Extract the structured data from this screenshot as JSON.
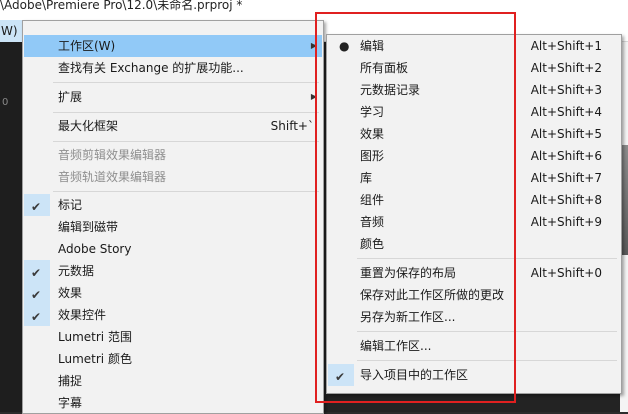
{
  "window": {
    "title": "\\Adobe\\Premiere Pro\\12.0\\未命名.prproj *",
    "menubar_selected": "W)"
  },
  "app": {
    "panel_number": "0"
  },
  "window_menu": {
    "items": [
      {
        "label": "工作区(W)",
        "highlight": true,
        "submenu": true
      },
      {
        "label": "查找有关 Exchange 的扩展功能..."
      },
      {
        "label": "扩展",
        "submenu": true
      },
      {
        "label": "最大化框架",
        "shortcut": "Shift+`"
      },
      {
        "label": "音频剪辑效果编辑器",
        "disabled": true
      },
      {
        "label": "音频轨道效果编辑器",
        "disabled": true
      },
      {
        "label": "标记",
        "checked": true
      },
      {
        "label": "编辑到磁带"
      },
      {
        "label": "Adobe Story"
      },
      {
        "label": "元数据",
        "checked": true
      },
      {
        "label": "效果",
        "checked": true
      },
      {
        "label": "效果控件",
        "checked": true
      },
      {
        "label": "Lumetri 范围"
      },
      {
        "label": "Lumetri 颜色"
      },
      {
        "label": "捕捉"
      },
      {
        "label": "字幕"
      }
    ]
  },
  "workspace_menu": {
    "items": [
      {
        "label": "编辑",
        "shortcut": "Alt+Shift+1",
        "active": true
      },
      {
        "label": "所有面板",
        "shortcut": "Alt+Shift+2"
      },
      {
        "label": "元数据记录",
        "shortcut": "Alt+Shift+3"
      },
      {
        "label": "学习",
        "shortcut": "Alt+Shift+4"
      },
      {
        "label": "效果",
        "shortcut": "Alt+Shift+5"
      },
      {
        "label": "图形",
        "shortcut": "Alt+Shift+6"
      },
      {
        "label": "库",
        "shortcut": "Alt+Shift+7"
      },
      {
        "label": "组件",
        "shortcut": "Alt+Shift+8"
      },
      {
        "label": "音频",
        "shortcut": "Alt+Shift+9"
      },
      {
        "label": "颜色"
      },
      {
        "label": "重置为保存的布局",
        "shortcut": "Alt+Shift+0"
      },
      {
        "label": "保存对此工作区所做的更改"
      },
      {
        "label": "另存为新工作区..."
      },
      {
        "label": "编辑工作区..."
      },
      {
        "label": "导入项目中的工作区",
        "checked": true
      }
    ]
  },
  "colors": {
    "highlight": "#91c9f7",
    "check_bg": "#cce4f7",
    "annotation": "#e02020"
  }
}
